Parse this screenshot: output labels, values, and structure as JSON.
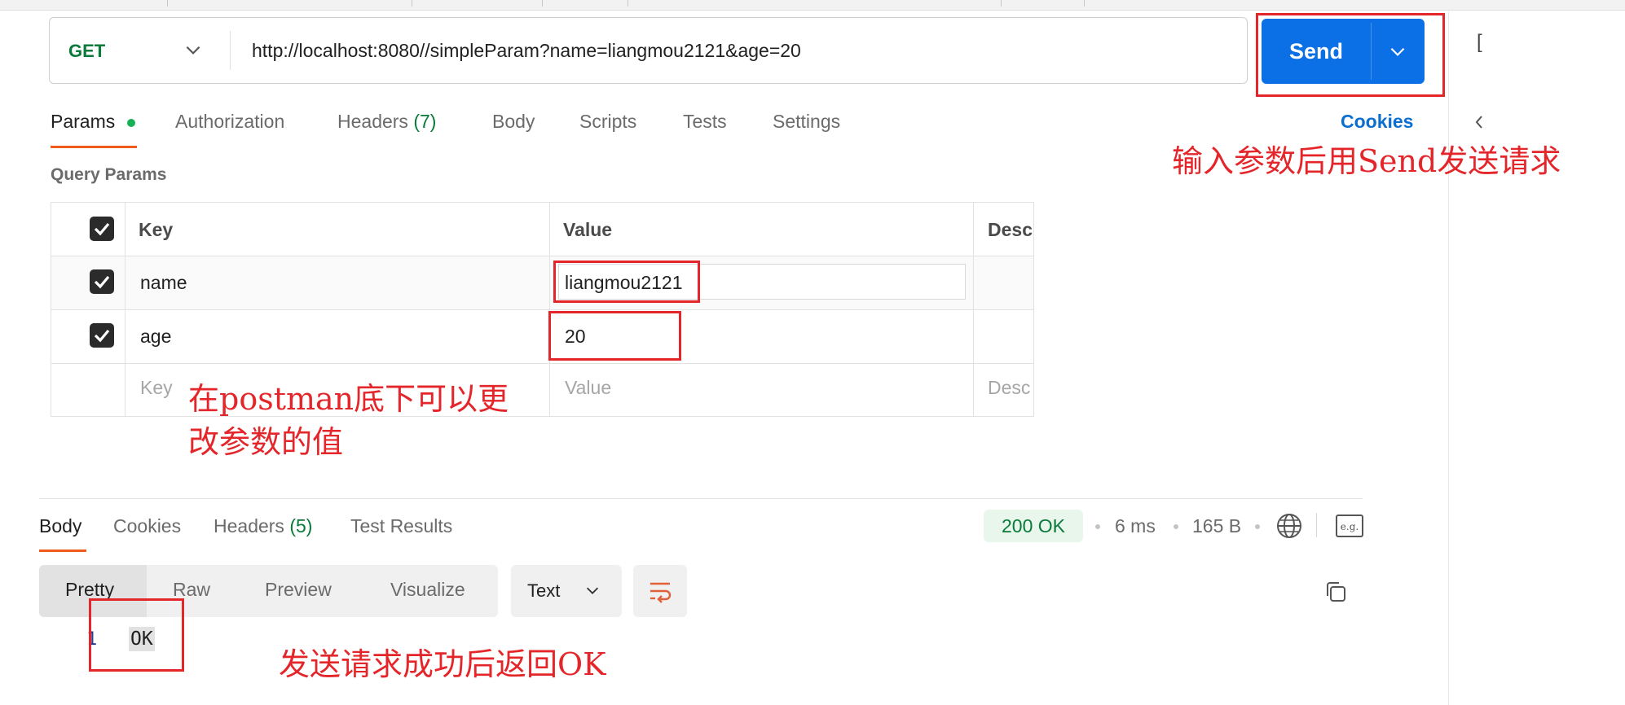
{
  "request": {
    "method": "GET",
    "url": "http://localhost:8080//simpleParam?name=liangmou2121&age=20",
    "send_label": "Send"
  },
  "side_glyph": "[",
  "tabs": [
    {
      "label": "Params"
    },
    {
      "label": "Authorization"
    },
    {
      "label": "Headers",
      "count": "(7)"
    },
    {
      "label": "Body"
    },
    {
      "label": "Scripts"
    },
    {
      "label": "Tests"
    },
    {
      "label": "Settings"
    }
  ],
  "cookies_link": "Cookies",
  "query_params": {
    "title": "Query Params",
    "headers": {
      "key": "Key",
      "value": "Value",
      "description": "Desc"
    },
    "rows": [
      {
        "key": "name",
        "value": "liangmou2121",
        "checked": true
      },
      {
        "key": "age",
        "value": "20",
        "checked": true
      }
    ],
    "placeholder": {
      "key": "Key",
      "value": "Value",
      "description": "Desc"
    }
  },
  "annotations": {
    "send_hint": "输入参数后用Send发送请求",
    "params_hint_line1": "在postman底下可以更",
    "params_hint_line2": "改参数的值",
    "response_hint": "发送请求成功后返回OK"
  },
  "response": {
    "tabs": [
      {
        "label": "Body"
      },
      {
        "label": "Cookies"
      },
      {
        "label": "Headers",
        "count": "(5)"
      },
      {
        "label": "Test Results"
      }
    ],
    "status": "200 OK",
    "time": "6 ms",
    "size": "165 B",
    "view_modes": [
      "Pretty",
      "Raw",
      "Preview",
      "Visualize"
    ],
    "format": "Text",
    "body_lines": [
      {
        "number": "1",
        "text": "OK"
      }
    ]
  },
  "colors": {
    "send_button": "#0b70e5",
    "method_get": "#0a7a3b",
    "annotation_red": "#e4262b",
    "active_tab_underline": "#f05a1a",
    "cookies_link": "#0b6fcf"
  },
  "icons": [
    "chevron-down-icon",
    "chevron-left-icon",
    "checkbox-checked-icon",
    "globe-icon",
    "example-icon",
    "wrap-lines-icon",
    "copy-icon"
  ]
}
